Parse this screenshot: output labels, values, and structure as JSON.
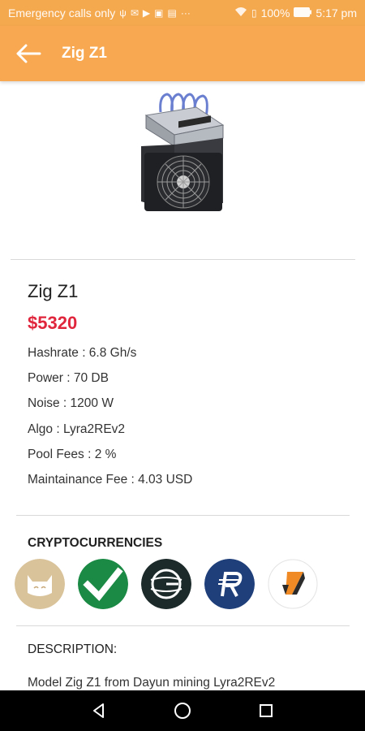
{
  "status_bar": {
    "left_text": "Emergency calls only",
    "battery": "100%",
    "time": "5:17 pm",
    "icons": [
      "usb-icon",
      "mail-icon",
      "youtube-icon",
      "photo-icon",
      "cast-icon",
      "more-icon",
      "wifi-icon",
      "sim-icon",
      "battery-icon"
    ]
  },
  "app_bar": {
    "title": "Zig Z1",
    "back_icon": "arrow-left-icon",
    "color": "#f7a850"
  },
  "product": {
    "image_icon": "asic-miner-image",
    "name": "Zig Z1",
    "price": "$5320",
    "price_color": "#e0263c",
    "specs": [
      "Hashrate : 6.8 Gh/s",
      "Power : 70 DB",
      "Noise : 1200 W",
      "Algo : Lyra2REv2",
      "Pool Fees : 2 %",
      "Maintainance Fee : 4.03 USD"
    ]
  },
  "cryptocurrencies": {
    "title": "CRYPTOCURRENCIES",
    "coins": [
      "cat-coin-icon",
      "checkmark-coin-icon",
      "g-coin-icon",
      "r-coin-icon",
      "orange-arrow-coin-icon"
    ]
  },
  "description": {
    "title": "DESCRIPTION:",
    "text": "Model Zig Z1 from Dayun mining Lyra2REv2"
  },
  "nav_bar": {
    "icons": [
      "back-triangle-icon",
      "home-circle-icon",
      "recents-square-icon"
    ]
  }
}
